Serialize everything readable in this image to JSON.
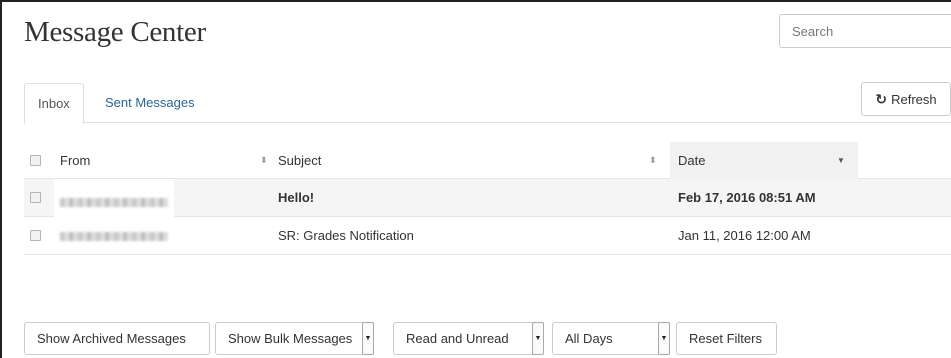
{
  "header": {
    "title": "Message Center",
    "search_placeholder": "Search"
  },
  "tabs": [
    {
      "label": "Inbox",
      "active": true
    },
    {
      "label": "Sent Messages",
      "active": false
    }
  ],
  "toolbar": {
    "refresh_icon": "refresh-icon",
    "refresh_label": "Refresh"
  },
  "table": {
    "columns": {
      "from": "From",
      "subject": "Subject",
      "date": "Date"
    },
    "sort_glyph": "⬍",
    "caret_glyph": "▼",
    "rows": [
      {
        "from": "[redacted]",
        "subject": "Hello!",
        "date": "Feb 17, 2016 08:51 AM",
        "unread": true
      },
      {
        "from": "[redacted]",
        "subject": "SR: Grades Notification",
        "date": "Jan 11, 2016 12:00 AM",
        "unread": false
      }
    ]
  },
  "filters": {
    "archived": "Show Archived Messages",
    "bulk": "Show Bulk Messages",
    "read_state": "Read and Unread",
    "days": "All Days",
    "reset": "Reset Filters",
    "dropdown_glyph": "▼"
  },
  "colors": {
    "link": "#2a6496",
    "sorted_header_bg": "#f1f1f1",
    "unread_row_bg": "#f5f5f5"
  }
}
